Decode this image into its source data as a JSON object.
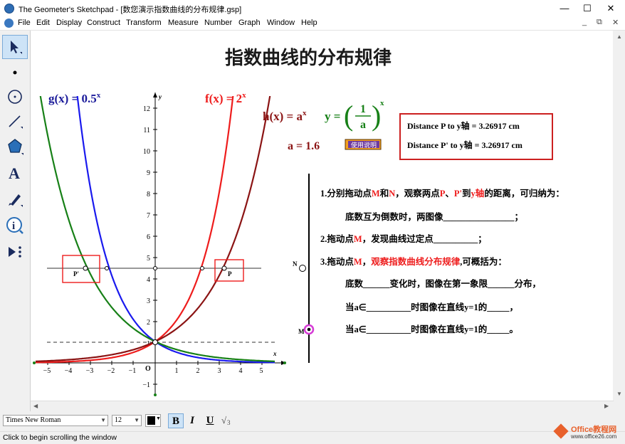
{
  "window": {
    "title": "The Geometer's Sketchpad - [数您演示指数曲线的分布规律.gsp]",
    "minimize": "—",
    "maximize": "☐",
    "close": "✕"
  },
  "menu": [
    "File",
    "Edit",
    "Display",
    "Construct",
    "Transform",
    "Measure",
    "Number",
    "Graph",
    "Window",
    "Help"
  ],
  "toolbox": {
    "tools": [
      "arrow-select-tool",
      "point-tool",
      "compass-tool",
      "straightedge-tool",
      "polygon-tool",
      "text-tool",
      "marker-tool",
      "information-tool",
      "custom-tool"
    ],
    "active": "arrow-select-tool"
  },
  "sketch": {
    "heading": "指数曲线的分布规律",
    "g_label": "g(x) = 0.5",
    "g_sup": "x",
    "f_label": "f(x) = 2",
    "f_sup": "x",
    "h_label": "h(x) = a",
    "h_sup": "x",
    "y_label": "y =",
    "frac_num": "1",
    "frac_den": "a",
    "y_sup": "x",
    "a_value": "a = 1.6",
    "usage_button": "使用说明",
    "dist_p": "Distance P to y轴 = 3.26917 cm",
    "dist_p2": "Distance P' to y轴 = 3.26917 cm",
    "point_p": "P",
    "point_p2": "P'",
    "point_n": "N",
    "point_m": "M",
    "axis_x": "x",
    "axis_y": "y",
    "origin": "O",
    "x_ticks": [
      "−5",
      "−4",
      "−3",
      "−2",
      "−1",
      "1",
      "2",
      "3",
      "4",
      "5"
    ],
    "y_ticks": [
      "12",
      "11",
      "10",
      "9",
      "8",
      "7",
      "6",
      "5",
      "4",
      "3",
      "2",
      "1",
      "−1"
    ],
    "line1": {
      "a": "1.分别拖动点",
      "b": "M",
      "c": "和",
      "d": "N",
      "e": "，观察两点",
      "f": "P",
      "g": "、",
      "h": "P'",
      "i": "到",
      "j": "y轴",
      "k": "的距离，可归纳为："
    },
    "line2": "底数互为倒数时，两图像________________；",
    "line3": {
      "a": "2.拖动点",
      "b": "M",
      "c": "，发现曲线过定点__________；"
    },
    "line4": {
      "a": "3.拖动点",
      "b": "M",
      "c": "，",
      "d": "观察指数曲线分布规律",
      "e": ",可概括为："
    },
    "line5": "底数______变化时，图像在第一象限______分布，",
    "line6": "当a∈__________时图像在直线y=1的_____，",
    "line7": "当a∈__________时图像在直线y=1的_____。"
  },
  "format": {
    "font": "Times New Roman",
    "size": "12",
    "bold": "B",
    "italic": "I",
    "underline": "U"
  },
  "status": "Click to begin scrolling the window",
  "watermark": {
    "brand": "Office教程网",
    "url": "www.office26.com"
  },
  "colors": {
    "red": "#ee1c1c",
    "blue": "#1a1aee",
    "green": "#178017",
    "darkred": "#8b1414"
  }
}
